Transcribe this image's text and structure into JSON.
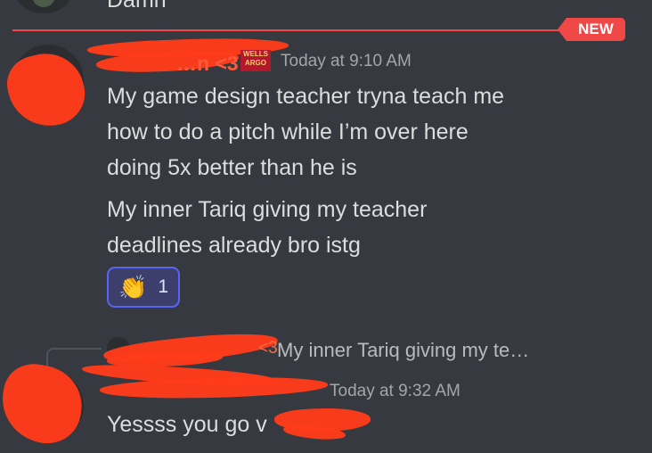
{
  "previous_message": {
    "text": "Damn"
  },
  "divider": {
    "label": "NEW"
  },
  "message1": {
    "username": "…n <3",
    "role_badge": "WELLS FARGO",
    "timestamp": "Today at 9:10 AM",
    "lines": [
      "My game design teacher tryna teach me",
      "how to do a pitch while I’m over here",
      "doing 5x better than he is",
      "My inner Tariq giving my teacher",
      "deadlines already bro istg"
    ],
    "reaction": {
      "emoji": "👏",
      "count": "1"
    }
  },
  "reply": {
    "username_suffix": "<3",
    "preview": "My inner Tariq giving my te…"
  },
  "message2": {
    "timestamp": "Today at 9:32 AM",
    "text": "Yessss you go v"
  },
  "colors": {
    "background": "#36393f",
    "new_divider": "#f04747",
    "reaction_border": "#5865f2",
    "redaction": "#ff3b1a"
  }
}
